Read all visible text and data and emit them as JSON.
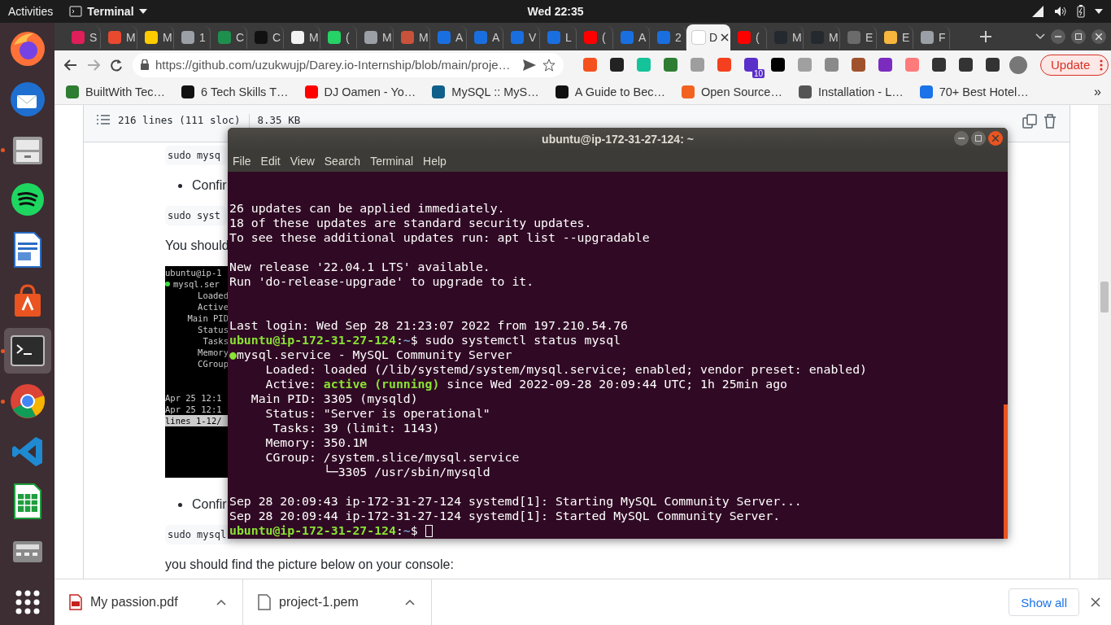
{
  "top_bar": {
    "activities": "Activities",
    "app_menu": "Terminal",
    "clock": "Wed 22:35"
  },
  "dock": [
    {
      "kind": "firefox",
      "running": false,
      "selected": false
    },
    {
      "kind": "mail",
      "running": false,
      "selected": false
    },
    {
      "kind": "files",
      "running": true,
      "selected": false
    },
    {
      "kind": "music",
      "running": false,
      "selected": false
    },
    {
      "kind": "writer",
      "running": false,
      "selected": false
    },
    {
      "kind": "store",
      "running": false,
      "selected": false
    },
    {
      "kind": "terminal",
      "running": true,
      "selected": true
    },
    {
      "kind": "chrome",
      "running": true,
      "selected": false
    },
    {
      "kind": "code",
      "running": false,
      "selected": false
    },
    {
      "kind": "sheet",
      "running": false,
      "selected": false
    },
    {
      "kind": "calculator",
      "running": false,
      "selected": false
    },
    {
      "kind": "apps",
      "running": false,
      "selected": false
    }
  ],
  "browser": {
    "tabs": [
      {
        "label": "S",
        "color": "#e01e5a",
        "selected": false
      },
      {
        "label": "M",
        "color": "#e8492f",
        "selected": false
      },
      {
        "label": "M",
        "color": "#ffcc00",
        "selected": false
      },
      {
        "label": "1",
        "color": "#9aa0a6",
        "selected": false
      },
      {
        "label": "C",
        "color": "#1f8f4e",
        "selected": false
      },
      {
        "label": "C",
        "color": "#111111",
        "selected": false
      },
      {
        "label": "M",
        "color": "#f2f2f2",
        "selected": false
      },
      {
        "label": "(",
        "color": "#25d366",
        "selected": false
      },
      {
        "label": "M",
        "color": "#9aa0a6",
        "selected": false
      },
      {
        "label": "M",
        "color": "#c9523a",
        "selected": false
      },
      {
        "label": "A",
        "color": "#1a6fe0",
        "selected": false
      },
      {
        "label": "A",
        "color": "#1a6fe0",
        "selected": false
      },
      {
        "label": "V",
        "color": "#1a6fe0",
        "selected": false
      },
      {
        "label": "L",
        "color": "#1a6fe0",
        "selected": false
      },
      {
        "label": "(",
        "color": "#ff0000",
        "selected": false
      },
      {
        "label": "A",
        "color": "#1a6fe0",
        "selected": false
      },
      {
        "label": "2",
        "color": "#1a6fe0",
        "selected": false
      },
      {
        "label": "D",
        "color": "#ffffff",
        "selected": true
      },
      {
        "label": "(",
        "color": "#ff0000",
        "selected": false
      },
      {
        "label": "M",
        "color": "#24292f",
        "selected": false
      },
      {
        "label": "M",
        "color": "#24292f",
        "selected": false
      },
      {
        "label": "E",
        "color": "#6b6b6b",
        "selected": false
      },
      {
        "label": "E",
        "color": "#f6b73c",
        "selected": false
      },
      {
        "label": "F",
        "color": "#9aa0a6",
        "selected": false
      }
    ],
    "url": "https://github.com/uzukwujp/Darey.io-Internship/blob/main/proje…",
    "extensions": [
      {
        "color": "#f4511e"
      },
      {
        "color": "#222222"
      },
      {
        "color": "#15c39a"
      },
      {
        "color": "#2e7d32"
      },
      {
        "color": "#9e9e9e"
      },
      {
        "color": "#f4401e"
      },
      {
        "color": "#5b2fc9",
        "badge": "10"
      },
      {
        "color": "#000000"
      },
      {
        "color": "#a0a0a0"
      },
      {
        "color": "#8a8a8a"
      },
      {
        "color": "#a0522d"
      },
      {
        "color": "#7b2cbf"
      },
      {
        "color": "#ff7a7a"
      },
      {
        "color": "#333333"
      },
      {
        "color": "#333333"
      },
      {
        "color": "#333333"
      }
    ],
    "update_button": "Update",
    "bookmarks": [
      {
        "label": "BuiltWith Tec…",
        "color": "#2e7d32"
      },
      {
        "label": "6 Tech Skills T…",
        "color": "#111111"
      },
      {
        "label": "DJ Oamen - Yo…",
        "color": "#ff0000"
      },
      {
        "label": "MySQL :: MyS…",
        "color": "#0f5f8a"
      },
      {
        "label": "A Guide to Bec…",
        "color": "#111111"
      },
      {
        "label": "Open Source…",
        "color": "#f26322"
      },
      {
        "label": "Installation - L…",
        "color": "#555555"
      },
      {
        "label": "70+ Best Hotel…",
        "color": "#1a73e8"
      }
    ],
    "bookmarks_overflow": "»"
  },
  "page": {
    "file_info": {
      "lines": "216 lines (111 sloc)",
      "size": "8.35 KB"
    },
    "content": [
      {
        "kind": "code",
        "text": "sudo mysq"
      },
      {
        "kind": "bullet",
        "text": "Confir"
      },
      {
        "kind": "code",
        "text": "sudo syst"
      },
      {
        "kind": "paragraph",
        "text": "You should"
      },
      {
        "kind": "screenshot",
        "lines": [
          {
            "kind": "plain",
            "text": "ubuntu@ip-1"
          },
          {
            "kind": "dot",
            "text": "mysql.ser"
          },
          {
            "kind": "label",
            "text": "Loaded"
          },
          {
            "kind": "label",
            "text": "Active"
          },
          {
            "kind": "label",
            "text": "Main PID"
          },
          {
            "kind": "label",
            "text": "Status"
          },
          {
            "kind": "label",
            "text": "Tasks"
          },
          {
            "kind": "label",
            "text": "Memory"
          },
          {
            "kind": "label",
            "text": "CGroup"
          },
          {
            "kind": "blank"
          },
          {
            "kind": "blank"
          },
          {
            "kind": "plain",
            "text": "Apr 25 12:1"
          },
          {
            "kind": "plain",
            "text": "Apr 25 12:1"
          },
          {
            "kind": "status",
            "text": "lines 1-12/"
          }
        ]
      },
      {
        "kind": "bullet",
        "text": "Confir"
      },
      {
        "kind": "code",
        "text": "sudo mysql"
      },
      {
        "kind": "paragraph",
        "text": "you should find the picture below on your console:"
      }
    ]
  },
  "terminal": {
    "title": "ubuntu@ip-172-31-27-124: ~",
    "menu": [
      "File",
      "Edit",
      "View",
      "Search",
      "Terminal",
      "Help"
    ],
    "lines": [
      {
        "kind": "blank"
      },
      {
        "kind": "blank"
      },
      {
        "kind": "text",
        "parts": [
          {
            "kind": "plain",
            "text": "26 updates can be applied immediately."
          }
        ]
      },
      {
        "kind": "text",
        "parts": [
          {
            "kind": "plain",
            "text": "18 of these updates are standard security updates."
          }
        ]
      },
      {
        "kind": "text",
        "parts": [
          {
            "kind": "plain",
            "text": "To see these additional updates run: apt list --upgradable"
          }
        ]
      },
      {
        "kind": "blank"
      },
      {
        "kind": "text",
        "parts": [
          {
            "kind": "plain",
            "text": "New release '22.04.1 LTS' available."
          }
        ]
      },
      {
        "kind": "text",
        "parts": [
          {
            "kind": "plain",
            "text": "Run 'do-release-upgrade' to upgrade to it."
          }
        ]
      },
      {
        "kind": "blank"
      },
      {
        "kind": "blank"
      },
      {
        "kind": "text",
        "parts": [
          {
            "kind": "plain",
            "text": "Last login: Wed Sep 28 21:23:07 2022 from 197.210.54.76"
          }
        ]
      },
      {
        "kind": "text",
        "parts": [
          {
            "kind": "user",
            "text": "ubuntu@ip-172-31-27-124"
          },
          {
            "kind": "plain",
            "text": ":"
          },
          {
            "kind": "path",
            "text": "~"
          },
          {
            "kind": "plain",
            "text": "$ sudo systemctl status mysql"
          }
        ]
      },
      {
        "kind": "text",
        "parts": [
          {
            "kind": "dot",
            "text": "●"
          },
          {
            "kind": "plain",
            "text": "mysql.service - MySQL Community Server"
          }
        ]
      },
      {
        "kind": "text",
        "parts": [
          {
            "kind": "plain",
            "text": "     Loaded: loaded (/lib/systemd/system/mysql.service; enabled; vendor preset: enabled)"
          }
        ]
      },
      {
        "kind": "text",
        "parts": [
          {
            "kind": "plain",
            "text": "     Active: "
          },
          {
            "kind": "ok",
            "text": "active (running)"
          },
          {
            "kind": "plain",
            "text": " since Wed 2022-09-28 20:09:44 UTC; 1h 25min ago"
          }
        ]
      },
      {
        "kind": "text",
        "parts": [
          {
            "kind": "plain",
            "text": "   Main PID: 3305 (mysqld)"
          }
        ]
      },
      {
        "kind": "text",
        "parts": [
          {
            "kind": "plain",
            "text": "     Status: \"Server is operational\""
          }
        ]
      },
      {
        "kind": "text",
        "parts": [
          {
            "kind": "plain",
            "text": "      Tasks: 39 (limit: 1143)"
          }
        ]
      },
      {
        "kind": "text",
        "parts": [
          {
            "kind": "plain",
            "text": "     Memory: 350.1M"
          }
        ]
      },
      {
        "kind": "text",
        "parts": [
          {
            "kind": "plain",
            "text": "     CGroup: /system.slice/mysql.service"
          }
        ]
      },
      {
        "kind": "text",
        "parts": [
          {
            "kind": "plain",
            "text": "             └─3305 /usr/sbin/mysqld"
          }
        ]
      },
      {
        "kind": "blank"
      },
      {
        "kind": "text",
        "parts": [
          {
            "kind": "plain",
            "text": "Sep 28 20:09:43 ip-172-31-27-124 systemd[1]: Starting MySQL Community Server..."
          }
        ]
      },
      {
        "kind": "text",
        "parts": [
          {
            "kind": "plain",
            "text": "Sep 28 20:09:44 ip-172-31-27-124 systemd[1]: Started MySQL Community Server."
          }
        ]
      },
      {
        "kind": "prompt",
        "parts": [
          {
            "kind": "user",
            "text": "ubuntu@ip-172-31-27-124"
          },
          {
            "kind": "plain",
            "text": ":"
          },
          {
            "kind": "path",
            "text": "~"
          },
          {
            "kind": "plain",
            "text": "$ "
          }
        ]
      }
    ]
  },
  "downloads": {
    "items": [
      {
        "kind": "pdf",
        "name": "My passion.pdf"
      },
      {
        "kind": "file",
        "name": "project-1.pem"
      }
    ],
    "show_all": "Show all"
  }
}
